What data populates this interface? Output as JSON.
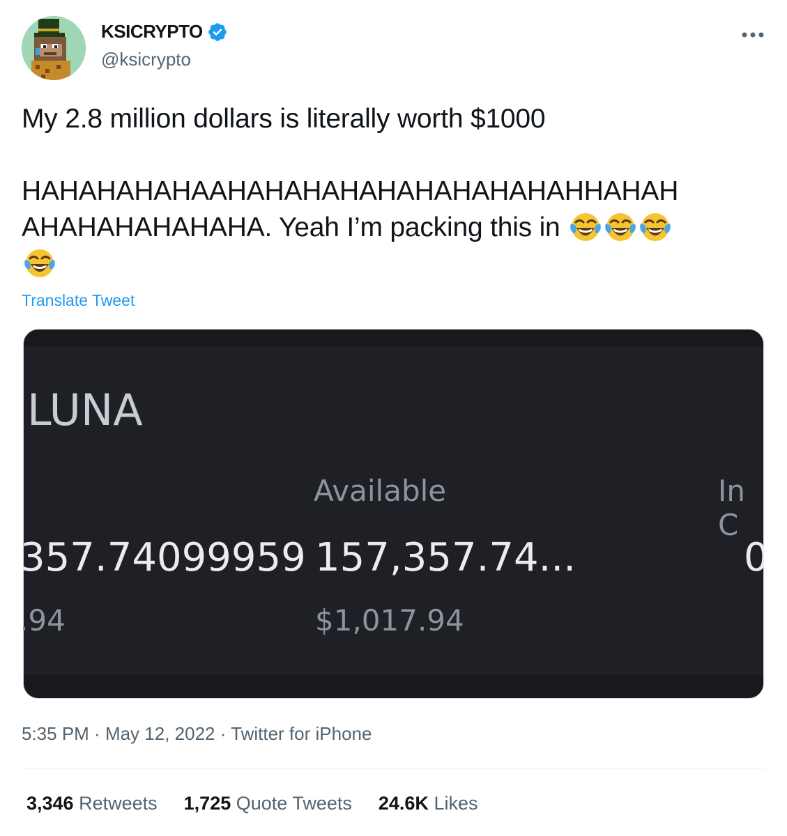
{
  "author": {
    "name": "KSICRYPTO",
    "handle": "@ksicrypto",
    "verified": true,
    "avatar_icon": "pixel-ape-avatar"
  },
  "more_menu_icon": "more-horizontal-icon",
  "tweet": {
    "line1": "My 2.8 million dollars is literally worth $1000",
    "line2": "HAHAHAHAHAAHAHAHAHAHAHAHAHAHAHHAHAH",
    "line3": "AHAHAHAHAHAHA. Yeah I’m packing this in",
    "emoji_icon": "face-with-tears-of-joy-emoji",
    "emoji_count": 4
  },
  "translate_label": "Translate Tweet",
  "media": {
    "coin": "LUNA",
    "available_header": "Available",
    "in_order_header": "In C",
    "total_value": "357.74099959",
    "available_value": "157,357.74...",
    "in_order_value": "0",
    "total_usd": ".94",
    "available_usd": "$1,017.94"
  },
  "meta": {
    "time": "5:35 PM",
    "sep1": " · ",
    "date": "May 12, 2022",
    "sep2": " · ",
    "source": "Twitter for iPhone"
  },
  "stats": {
    "retweets_count": "3,346",
    "retweets_label": "Retweets",
    "quotes_count": "1,725",
    "quotes_label": "Quote Tweets",
    "likes_count": "24.6K",
    "likes_label": "Likes"
  },
  "colors": {
    "accent": "#1d9bf0",
    "secondary_text": "#536471",
    "media_bg": "#1e2026"
  }
}
